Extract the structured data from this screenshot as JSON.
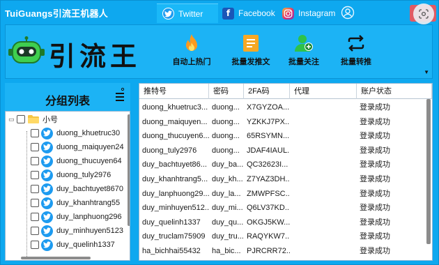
{
  "app": {
    "title": "TuiGuangs引流王机器人"
  },
  "tabs": [
    {
      "label": "Twitter",
      "icon": "twitter-icon",
      "active": true
    },
    {
      "label": "Facebook",
      "icon": "facebook-icon",
      "active": false
    },
    {
      "label": "Instagram",
      "icon": "instagram-icon",
      "active": false
    }
  ],
  "banner": {
    "brand": "引流王",
    "tools": [
      {
        "label": "自动上热门",
        "icon": "fire-icon"
      },
      {
        "label": "批量发推文",
        "icon": "document-icon"
      },
      {
        "label": "批量关注",
        "icon": "add-user-icon"
      },
      {
        "label": "批量转推",
        "icon": "retweet-icon"
      }
    ]
  },
  "left_panel": {
    "title": "分组列表",
    "group_menu_icon": "list-menu-icon",
    "tree": {
      "group_label": "小号",
      "expander": "▭",
      "items": [
        "duong_khuetruc30",
        "duong_maiquyen24",
        "duong_thucuyen64",
        "duong_tuly2976",
        "duy_bachtuyet8670",
        "duy_khanhtrang55",
        "duy_lanphuong296",
        "duy_minhuyen5123",
        "duy_quelinh1337"
      ]
    }
  },
  "grid": {
    "columns": [
      "推特号",
      "密码",
      "2FA码",
      "代理",
      "账户状态"
    ],
    "rows": [
      {
        "account": "duong_khuetruc3...",
        "password": "duong...",
        "twofa": "X7GYZOA...",
        "proxy": "",
        "status": "登录成功"
      },
      {
        "account": "duong_maiquyen...",
        "password": "duong...",
        "twofa": "YZKKJ7PX...",
        "proxy": "",
        "status": "登录成功"
      },
      {
        "account": "duong_thucuyen6...",
        "password": "duong...",
        "twofa": "65RSYMN...",
        "proxy": "",
        "status": "登录成功"
      },
      {
        "account": "duong_tuly2976",
        "password": "duong...",
        "twofa": "JDAF4IAUL...",
        "proxy": "",
        "status": "登录成功"
      },
      {
        "account": "duy_bachtuyet86...",
        "password": "duy_ba...",
        "twofa": "QC32623I...",
        "proxy": "",
        "status": "登录成功"
      },
      {
        "account": "duy_khanhtrang5...",
        "password": "duy_kh...",
        "twofa": "Z7YAZ3DH...",
        "proxy": "",
        "status": "登录成功"
      },
      {
        "account": "duy_lanphuong29...",
        "password": "duy_la...",
        "twofa": "ZMWPFSC...",
        "proxy": "",
        "status": "登录成功"
      },
      {
        "account": "duy_minhuyen512...",
        "password": "duy_mi...",
        "twofa": "Q6LV37KD...",
        "proxy": "",
        "status": "登录成功"
      },
      {
        "account": "duy_quelinh1337",
        "password": "duy_qu...",
        "twofa": "OKGJ5KW...",
        "proxy": "",
        "status": "登录成功"
      },
      {
        "account": "duy_truclam75909",
        "password": "duy_tru...",
        "twofa": "RAQYKW7...",
        "proxy": "",
        "status": "登录成功"
      },
      {
        "account": "ha_bichhai55432",
        "password": "ha_bic...",
        "twofa": "PJRCRR72...",
        "proxy": "",
        "status": "登录成功"
      }
    ]
  },
  "colors": {
    "window_bg": "#0ea8ef",
    "panel_bg": "#1cb3f5",
    "twitter_blue": "#1d9bf0",
    "close_red": "#e05a64"
  }
}
